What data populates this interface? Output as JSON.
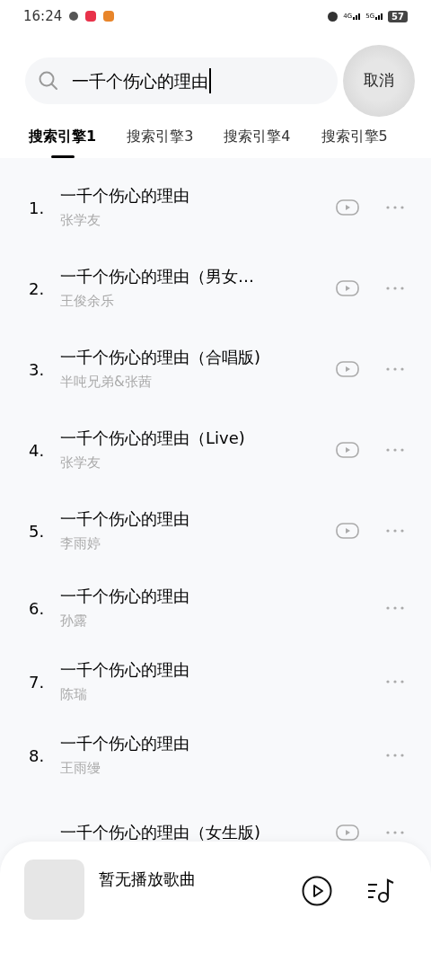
{
  "status_bar": {
    "time": "16:24",
    "network": [
      "4G",
      "5G"
    ],
    "battery": "57"
  },
  "search": {
    "value": "一千个伤心的理由",
    "cancel": "取消"
  },
  "tabs": [
    {
      "label": "搜索引擎1",
      "selected": true
    },
    {
      "label": "搜索引擎3",
      "selected": false
    },
    {
      "label": "搜索引擎4",
      "selected": false
    },
    {
      "label": "搜索引擎5",
      "selected": false
    }
  ],
  "songs": [
    {
      "number": "1.",
      "title": "一千个伤心的理由",
      "artist": "张学友",
      "mv": true
    },
    {
      "number": "2.",
      "title": "一千个伤心的理由（男女…",
      "artist": "王俊余乐",
      "mv": true
    },
    {
      "number": "3.",
      "title": "一千个伤心的理由（合唱版)",
      "artist": "半吨兄弟&张茜",
      "mv": true
    },
    {
      "number": "4.",
      "title": "一千个伤心的理由（Live)",
      "artist": "张学友",
      "mv": true
    },
    {
      "number": "5.",
      "title": "一千个伤心的理由",
      "artist": "李雨婷",
      "mv": true
    },
    {
      "number": "6.",
      "title": "一千个伤心的理由",
      "artist": "孙露",
      "mv": false
    },
    {
      "number": "7.",
      "title": "一千个伤心的理由",
      "artist": "陈瑞",
      "mv": false
    },
    {
      "number": "8.",
      "title": "一千个伤心的理由",
      "artist": "王雨缦",
      "mv": false
    },
    {
      "title": "一千个伤心的理由（女生版)",
      "mv": true
    }
  ],
  "player": {
    "title": "暂无播放歌曲"
  }
}
